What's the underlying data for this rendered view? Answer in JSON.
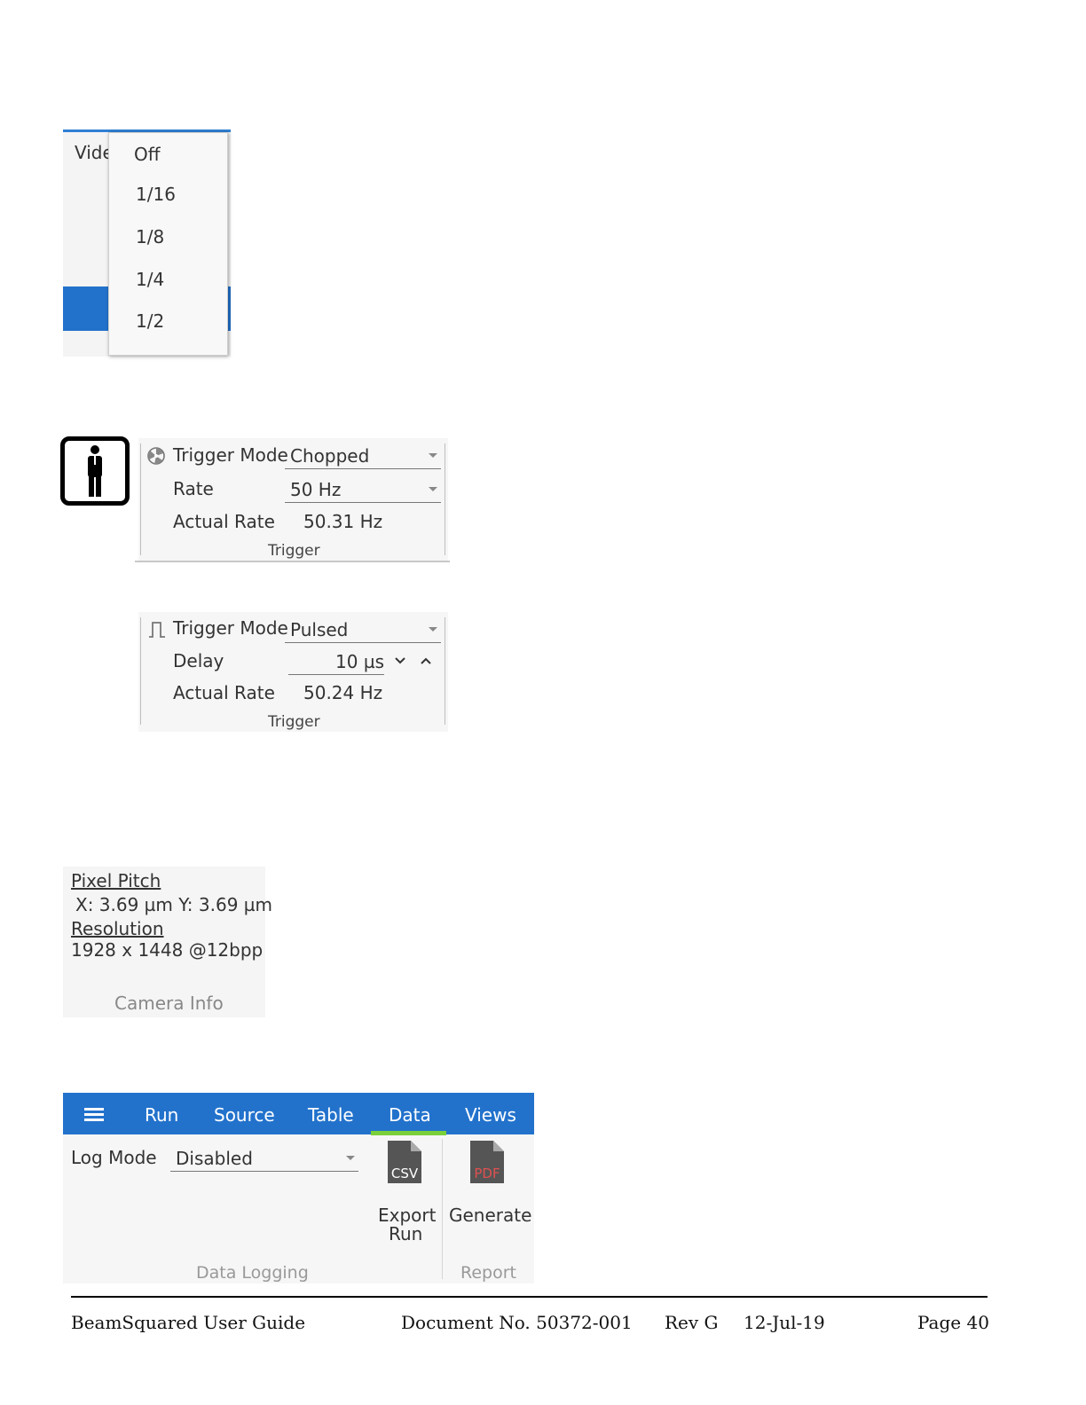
{
  "video_dropdown": {
    "label": "Vide",
    "options": [
      "Off",
      "1/16",
      "1/8",
      "1/4",
      "1/2"
    ]
  },
  "trigger_chopped": {
    "mode_label": "Trigger Mode",
    "mode_value": "Chopped",
    "rate_label": "Rate",
    "rate_value": "50 Hz",
    "actual_rate_label": "Actual Rate",
    "actual_rate_value": "50.31 Hz",
    "group_label": "Trigger"
  },
  "trigger_pulsed": {
    "mode_label": "Trigger Mode",
    "mode_value": "Pulsed",
    "delay_label": "Delay",
    "delay_value": "10 µs",
    "actual_rate_label": "Actual Rate",
    "actual_rate_value": "50.24 Hz",
    "group_label": "Trigger"
  },
  "camera_info": {
    "pixel_pitch_label": "Pixel Pitch",
    "pixel_pitch_value": "X: 3.69 µm Y: 3.69 µm",
    "resolution_label": "Resolution",
    "resolution_value": "1928 x 1448 @12bpp",
    "group_label": "Camera Info"
  },
  "ribbon": {
    "tabs": [
      "Run",
      "Source",
      "Table",
      "Data",
      "Views"
    ],
    "active_tab": "Data",
    "log_mode_label": "Log Mode",
    "log_mode_value": "Disabled",
    "csv_icon_text": "CSV",
    "export_label_1": "Export",
    "export_label_2": "Run",
    "pdf_icon_text": "PDF",
    "generate_label": "Generate",
    "data_logging_group": "Data Logging",
    "report_group": "Report",
    "colors": {
      "bar": "#2272cc",
      "active_indicator": "#7ad03a",
      "pdf_text": "#e05050"
    }
  },
  "footer": {
    "title": "BeamSquared User Guide",
    "doc_no": "Document No. 50372-001",
    "rev": "Rev G",
    "date": "12-Jul-19",
    "page": "Page 40"
  }
}
